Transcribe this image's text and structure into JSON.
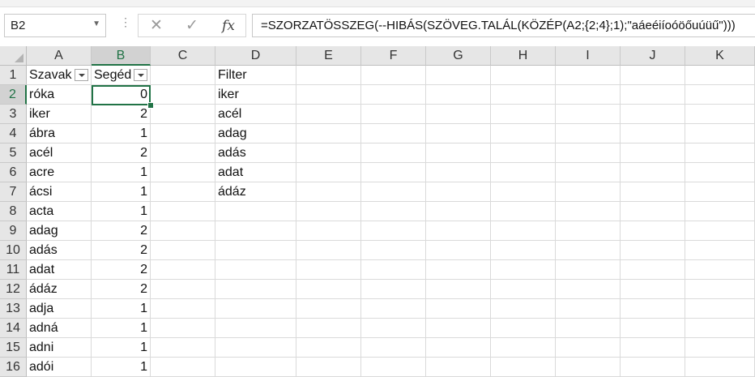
{
  "name_box": {
    "value": "B2",
    "dropdown_icon": "chevron-down-icon"
  },
  "formula_bar": {
    "cancel_icon": "✕",
    "enter_icon": "✓",
    "fx_label": "fx",
    "formula": "=SZORZATÖSSZEG(--HIBÁS(SZÖVEG.TALÁL(KÖZÉP(A2;{2;4};1);\"aáeéiíoóöőuúüű\")))"
  },
  "sheet": {
    "columns": [
      "A",
      "B",
      "C",
      "D",
      "E",
      "F",
      "G",
      "H",
      "I",
      "J",
      "K"
    ],
    "rows": [
      "1",
      "2",
      "3",
      "4",
      "5",
      "6",
      "7",
      "8",
      "9",
      "10",
      "11",
      "12",
      "13",
      "14",
      "15",
      "16"
    ],
    "selected_cell": "B2",
    "headers": {
      "a": "Szavak",
      "b": "Segéd",
      "d": "Filter"
    },
    "col_a": [
      "róka",
      "iker",
      "ábra",
      "acél",
      "acre",
      "ácsi",
      "acta",
      "adag",
      "adás",
      "adat",
      "ádáz",
      "adja",
      "adná",
      "adni",
      "adói"
    ],
    "col_b": [
      "0",
      "2",
      "1",
      "2",
      "1",
      "1",
      "1",
      "2",
      "2",
      "2",
      "2",
      "1",
      "1",
      "1",
      "1"
    ],
    "col_d": [
      "iker",
      "acél",
      "adag",
      "adás",
      "adat",
      "ádáz"
    ]
  }
}
